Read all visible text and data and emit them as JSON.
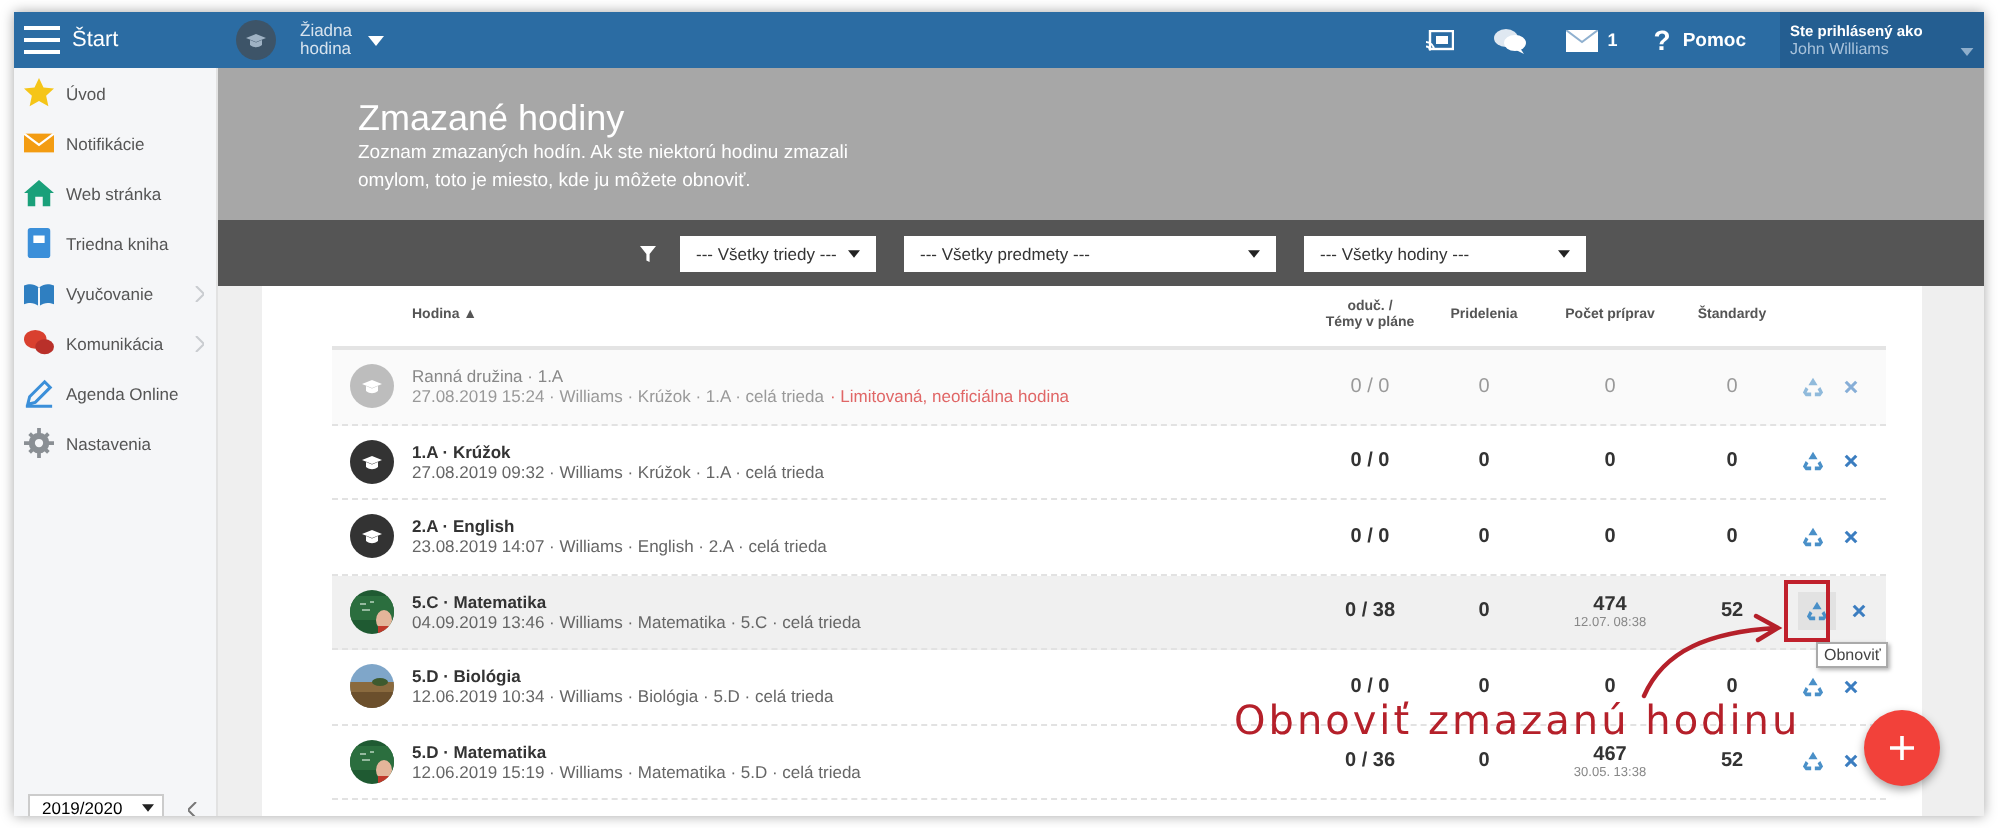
{
  "topbar": {
    "menu_label": "Štart",
    "lesson_selector": "Žiadna hodina",
    "mail_count": "1",
    "help_glyph": "?",
    "help_label": "Pomoc",
    "user_caption": "Ste prihlásený ako",
    "user_name": "John Williams"
  },
  "sidebar": {
    "items": [
      {
        "label": "Úvod",
        "has_submenu": false
      },
      {
        "label": "Notifikácie",
        "has_submenu": false
      },
      {
        "label": "Web stránka",
        "has_submenu": false
      },
      {
        "label": "Triedna kniha",
        "has_submenu": false
      },
      {
        "label": "Vyučovanie",
        "has_submenu": true
      },
      {
        "label": "Komunikácia",
        "has_submenu": true
      },
      {
        "label": "Agenda Online",
        "has_submenu": false
      },
      {
        "label": "Nastavenia",
        "has_submenu": false
      }
    ],
    "school_year": "2019/2020"
  },
  "page": {
    "title": "Zmazané hodiny",
    "description": "Zoznam zmazaných hodín. Ak ste niektorú hodinu zmazali omylom, toto je miesto, kde ju môžete obnoviť."
  },
  "filters": [
    "--- Všetky triedy ---",
    "--- Všetky predmety ---",
    "--- Všetky hodiny ---"
  ],
  "table": {
    "columns": [
      "Hodina ▲",
      "oduč. /\nTémy v pláne",
      "Pridelenia",
      "Počet príprav",
      "Štandardy"
    ],
    "rows": [
      {
        "title": "Ranná družina · 1.A",
        "meta": "27.08.2019 15:24 · Williams · Krúžok · 1.A · celá trieda",
        "note": "· Limitovaná, neoficiálna hodina",
        "kind": "cap",
        "dimmed": true,
        "hovered": false,
        "taught": "0 / 0",
        "assigned": "0",
        "preps": "0",
        "standards": "0"
      },
      {
        "title": "1.A · Krúžok",
        "meta": "27.08.2019 09:32 · Williams · Krúžok · 1.A · celá trieda",
        "kind": "cap",
        "dimmed": false,
        "hovered": false,
        "taught": "0 / 0",
        "assigned": "0",
        "preps": "0",
        "standards": "0"
      },
      {
        "title": "2.A · English",
        "meta": "23.08.2019 14:07 · Williams · English · 2.A · celá trieda",
        "kind": "cap",
        "dimmed": false,
        "hovered": false,
        "taught": "0 / 0",
        "assigned": "0",
        "preps": "0",
        "standards": "0"
      },
      {
        "title": "5.C · Matematika",
        "meta": "04.09.2019 13:46 · Williams · Matematika · 5.C · celá trieda",
        "kind": "picture",
        "dimmed": false,
        "hovered": true,
        "taught": "0 / 38",
        "assigned": "0",
        "preps": "474",
        "preps_date": "12.07. 08:38",
        "standards": "52"
      },
      {
        "title": "5.D · Biológia",
        "meta": "12.06.2019 10:34 · Williams · Biológia · 5.D · celá trieda",
        "kind": "picture",
        "dimmed": false,
        "hovered": false,
        "taught": "0 / 0",
        "assigned": "0",
        "preps": "0",
        "standards": "0"
      },
      {
        "title": "5.D · Matematika",
        "meta": "12.06.2019 15:19 · Williams · Matematika · 5.D · celá trieda",
        "kind": "picture",
        "dimmed": false,
        "hovered": false,
        "taught": "0 / 36",
        "assigned": "0",
        "preps": "467",
        "preps_date": "30.05. 13:38",
        "standards": "52"
      }
    ]
  },
  "tooltip": "Obnoviť",
  "callout": "Obnoviť zmazanú hodinu"
}
